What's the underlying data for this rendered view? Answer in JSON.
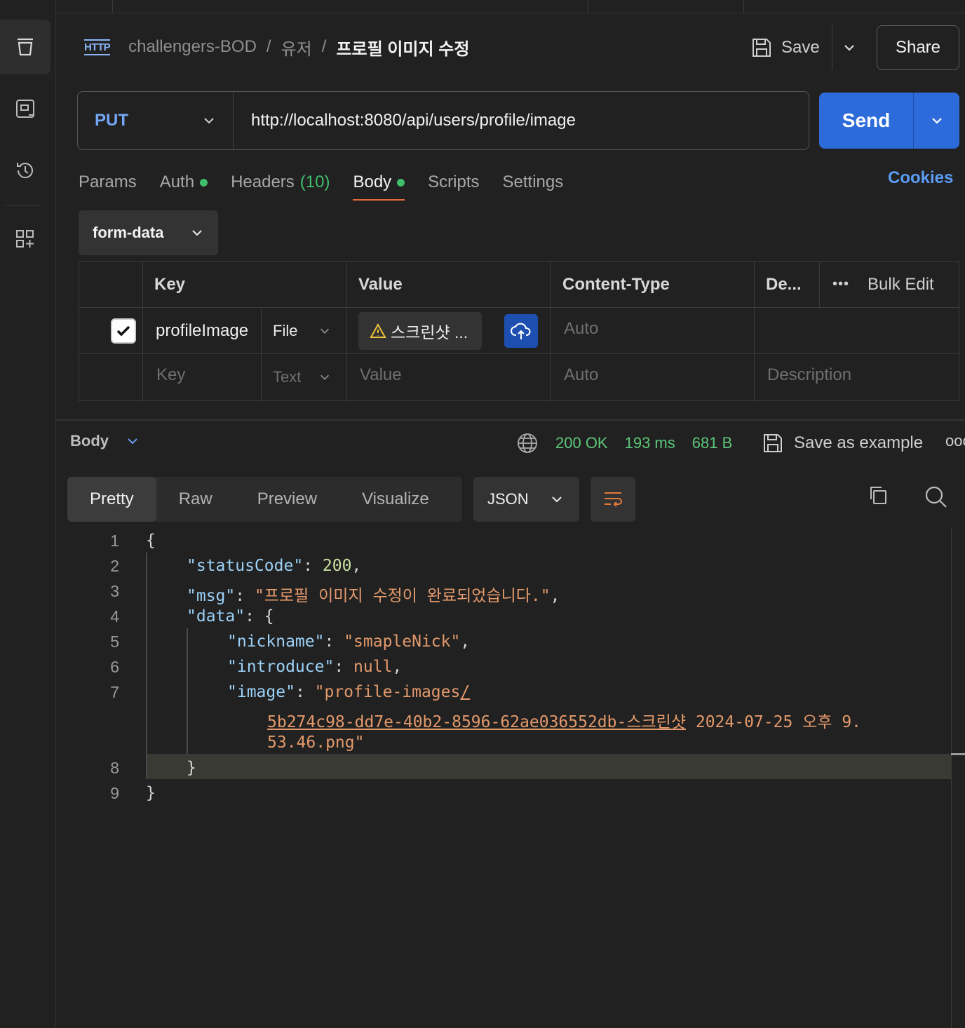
{
  "breadcrumb": {
    "badge": "HTTP",
    "collection": "challengers-BOD",
    "folder": "유저",
    "request": "프로필 이미지 수정"
  },
  "header": {
    "save_label": "Save",
    "share_label": "Share"
  },
  "request": {
    "method": "PUT",
    "url": "http://localhost:8080/api/users/profile/image",
    "send_label": "Send"
  },
  "tabs": {
    "params": "Params",
    "auth": "Auth",
    "headers": "Headers",
    "headers_count": "(10)",
    "body": "Body",
    "scripts": "Scripts",
    "settings": "Settings",
    "cookies": "Cookies"
  },
  "body_type": "form-data",
  "form_table": {
    "headers": {
      "key": "Key",
      "value": "Value",
      "content_type": "Content-Type",
      "description": "De...",
      "bulk_edit": "Bulk Edit"
    },
    "row1": {
      "key": "profileImage",
      "type": "File",
      "value": "스크린샷 ...",
      "content_type": "Auto"
    },
    "placeholder_row": {
      "key": "Key",
      "type": "Text",
      "value": "Value",
      "content_type": "Auto",
      "description": "Description"
    }
  },
  "response": {
    "body_label": "Body",
    "status": "200 OK",
    "time": "193 ms",
    "size": "681 B",
    "save_example": "Save as example",
    "more": "ooo",
    "view_tabs": [
      "Pretty",
      "Raw",
      "Preview",
      "Visualize"
    ],
    "format": "JSON"
  },
  "code": {
    "line_numbers": [
      "1",
      "2",
      "3",
      "4",
      "5",
      "6",
      "7",
      "8",
      "9"
    ],
    "open_brace": "{",
    "status_key": "\"statusCode\"",
    "status_val": "200",
    "msg_key": "\"msg\"",
    "msg_val": "\"프로필 이미지 수정이 완료되었습니다.\"",
    "data_key": "\"data\"",
    "nickname_key": "\"nickname\"",
    "nickname_val": "\"smapleNick\"",
    "introduce_key": "\"introduce\"",
    "introduce_val": "null",
    "image_key": "\"image\"",
    "image_val_1a": "\"profile-images",
    "image_val_1b": "/",
    "image_val_2a": "5b274c98-dd7e-40b2-8596-62ae036552db-스크린샷",
    "image_val_2b": " 2024-07-25 오후 9.",
    "image_val_3": "53.46.png\"",
    "close_inner": "}",
    "close_outer": "}"
  },
  "colors": {
    "accent_blue": "#2c6bd9",
    "tab_underline": "#e3693b",
    "status_green": "#5ec77a"
  }
}
